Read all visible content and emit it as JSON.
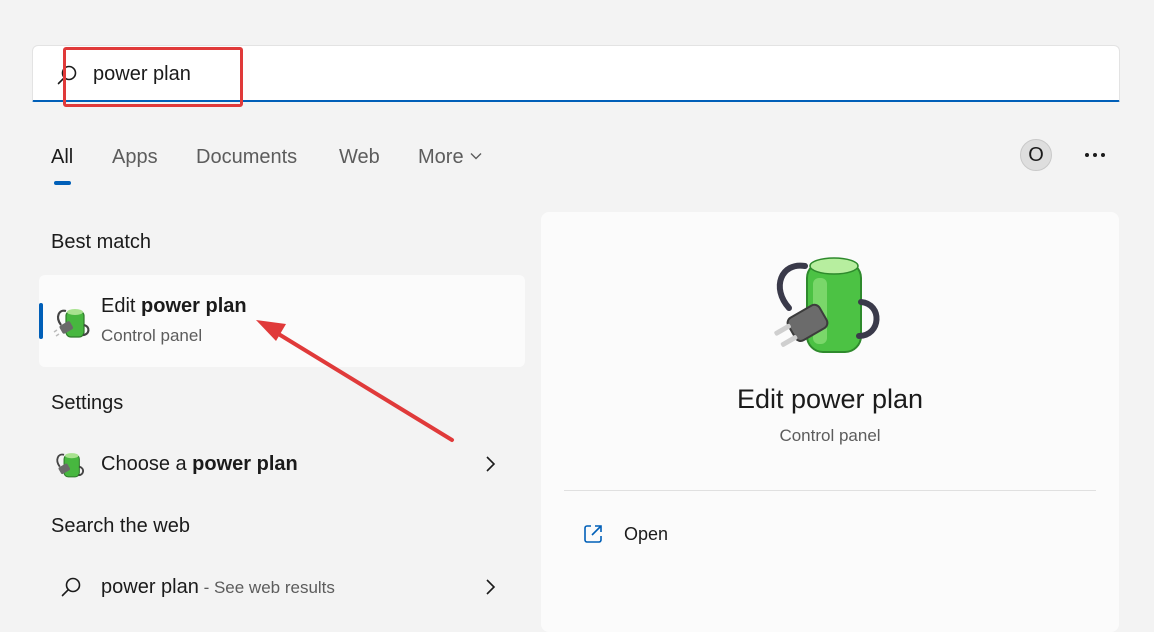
{
  "search": {
    "value": "power plan",
    "placeholder": ""
  },
  "tabs": [
    {
      "label": "All",
      "active": true
    },
    {
      "label": "Apps"
    },
    {
      "label": "Documents"
    },
    {
      "label": "Web"
    },
    {
      "label": "More"
    }
  ],
  "account": {
    "initial": "O"
  },
  "best_match": {
    "heading": "Best match",
    "title_prefix": "Edit ",
    "title_bold": "power plan",
    "subtitle": "Control panel"
  },
  "settings": {
    "heading": "Settings",
    "title_prefix": "Choose a ",
    "title_bold": "power plan"
  },
  "web": {
    "heading": "Search the web",
    "query": "power plan",
    "suffix": " - See web results"
  },
  "details": {
    "title": "Edit power plan",
    "subtitle": "Control panel",
    "actions": [
      {
        "label": "Open",
        "icon": "open-external-icon"
      }
    ]
  },
  "colors": {
    "accent": "#005fb8",
    "annotation": "#e03a3a"
  }
}
